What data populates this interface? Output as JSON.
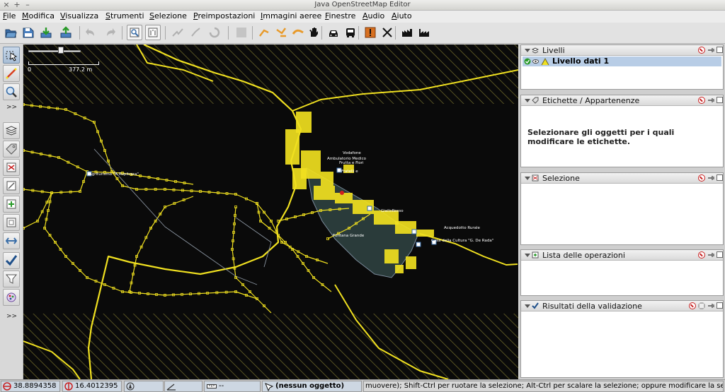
{
  "window": {
    "title": "Java OpenStreetMap Editor",
    "left_controls": [
      "×",
      "+",
      "–"
    ],
    "right_controls": [
      "−",
      "□",
      "×"
    ]
  },
  "menu": [
    {
      "label": "File",
      "mnemonic_index": 0
    },
    {
      "label": "Modifica",
      "mnemonic_index": 0
    },
    {
      "label": "Visualizza",
      "mnemonic_index": 0
    },
    {
      "label": "Strumenti",
      "mnemonic_index": 0
    },
    {
      "label": "Selezione",
      "mnemonic_index": 0
    },
    {
      "label": "Preimpostazioni",
      "mnemonic_index": 0
    },
    {
      "label": "Immagini aeree",
      "mnemonic_index": 0
    },
    {
      "label": "Finestre",
      "mnemonic_index": 0
    },
    {
      "label": "Audio",
      "mnemonic_index": 0
    },
    {
      "label": "Aiuto",
      "mnemonic_index": 0
    }
  ],
  "toolbar_icons": [
    "open-file-icon",
    "save-icon",
    "download-icon",
    "upload-icon",
    "undo-icon",
    "redo-icon",
    "preferences-icon",
    "info-icon",
    "split-way-icon",
    "combine-way-icon",
    "reverse-way-icon",
    "delete-icon",
    "orange-draw-1-icon",
    "orange-draw-2-icon",
    "orange-draw-3-icon",
    "hand-icon",
    "car-icon",
    "bus-icon",
    "warning-icon",
    "close-x-icon",
    "building-icon",
    "factory-icon"
  ],
  "left_tools": [
    "select-tool-icon",
    "draw-tool-icon",
    "zoom-tool-icon",
    "layers-toggle-icon",
    "tags-toggle-icon",
    "selection-list-icon",
    "relations-list-icon",
    "commands-icon",
    "conflicts-icon",
    "validation-icon",
    "filter-icon",
    "map-paint-icon"
  ],
  "left_more_label": ">>",
  "scale": {
    "left": "0",
    "right": "377.2 m",
    "slider_value": 0.6
  },
  "map_labels": [
    {
      "text": "Agriturismo \"A Rupitrara\""
    },
    {
      "text": "Vodafone"
    },
    {
      "text": "Ambulatorio Medico"
    },
    {
      "text": "Frutta e Fiori"
    },
    {
      "text": "Fratelli e"
    },
    {
      "text": "GialloRosso"
    },
    {
      "text": "Acquedotto Rurale"
    },
    {
      "text": "Fontana Grande"
    },
    {
      "text": "Casa della Cultura \"G. De Rada\""
    }
  ],
  "panels": {
    "layers": {
      "title": "Livelli",
      "items": [
        {
          "label": "Livello dati 1",
          "active": true,
          "visible": true
        }
      ]
    },
    "tags": {
      "title": "Etichette / Appartenenze",
      "message": "Selezionare gli oggetti per i quali modificare le etichette."
    },
    "selection": {
      "title": "Selezione"
    },
    "commands": {
      "title": "Lista delle operazioni"
    },
    "validation": {
      "title": "Risultati della validazione"
    }
  },
  "status": {
    "lat": "38.8894358",
    "lon": "16.4012395",
    "heading": "",
    "angle": "",
    "distance": "--",
    "object": "(nessun oggetto)",
    "help": "muovere); Shift-Ctrl per ruotare la selezione; Alt-Ctrl per scalare la selezione; oppure modificare la selezione"
  },
  "colors": {
    "map_bg": "#0a0a0a",
    "way": "#f0e020",
    "node": "#f0e020",
    "area_fill": "#2a3b3a",
    "selected_layer_bg": "#b8cde6"
  }
}
